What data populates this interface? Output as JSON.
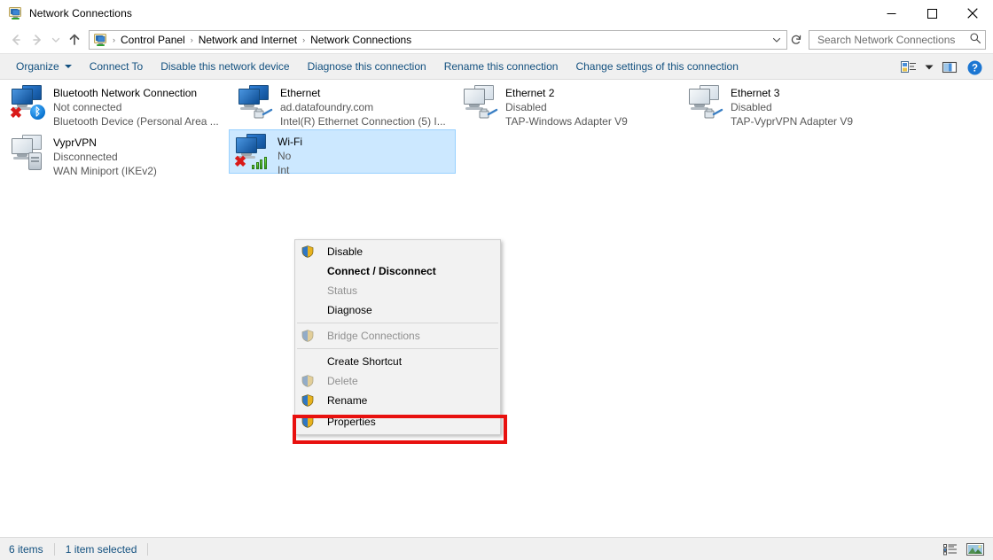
{
  "window": {
    "title": "Network Connections",
    "icon": "network-connections-icon",
    "buttons": {
      "minimize": "minimize-button",
      "maximize": "maximize-button",
      "close": "close-button"
    }
  },
  "navigation": {
    "back": "back-button",
    "forward": "forward-button",
    "recent": "recent-locations-button",
    "up": "up-button"
  },
  "address": {
    "icon": "network-connections-icon",
    "crumbs": [
      "Control Panel",
      "Network and Internet",
      "Network Connections"
    ],
    "separator": "›",
    "dropdown": "address-dropdown",
    "refresh": "refresh-button"
  },
  "search": {
    "placeholder": "Search Network Connections",
    "value": "",
    "icon": "search-icon"
  },
  "toolbar": {
    "items": [
      {
        "label": "Organize",
        "has_caret": true
      },
      {
        "label": "Connect To",
        "has_caret": false
      },
      {
        "label": "Disable this network device",
        "has_caret": false
      },
      {
        "label": "Diagnose this connection",
        "has_caret": false
      },
      {
        "label": "Rename this connection",
        "has_caret": false
      },
      {
        "label": "Change settings of this connection",
        "has_caret": false
      }
    ],
    "right_icons": [
      {
        "name": "change-view-icon"
      },
      {
        "name": "change-view-caret-icon"
      },
      {
        "name": "preview-pane-icon"
      },
      {
        "name": "help-icon"
      }
    ]
  },
  "connections": [
    {
      "name": "Bluetooth Network Connection",
      "status": "Not connected",
      "device": "Bluetooth Device (Personal Area ...",
      "icon": "network-adapter-icon",
      "badge": "bluetooth",
      "disconnected": true,
      "selected": false,
      "col": 0,
      "row": 0
    },
    {
      "name": "VyprVPN",
      "status": "Disconnected",
      "device": "WAN Miniport (IKEv2)",
      "icon": "network-adapter-icon",
      "badge": "server",
      "disconnected": false,
      "dimmed": true,
      "selected": false,
      "col": 0,
      "row": 1
    },
    {
      "name": "Ethernet",
      "status": "ad.datafoundry.com",
      "device": "Intel(R) Ethernet Connection (5) I...",
      "icon": "network-adapter-icon",
      "badge": "rj45",
      "disconnected": false,
      "selected": false,
      "col": 1,
      "row": 0
    },
    {
      "name": "Wi-Fi",
      "status": "No",
      "device": "Int",
      "icon": "network-adapter-icon",
      "badge": "wifi",
      "disconnected": true,
      "selected": true,
      "col": 1,
      "row": 1
    },
    {
      "name": "Ethernet 2",
      "status": "Disabled",
      "device": "TAP-Windows Adapter V9",
      "icon": "network-adapter-icon",
      "badge": "rj45",
      "disconnected": false,
      "dimmed": true,
      "selected": false,
      "col": 2,
      "row": 0
    },
    {
      "name": "Ethernet 3",
      "status": "Disabled",
      "device": "TAP-VyprVPN Adapter V9",
      "icon": "network-adapter-icon",
      "badge": "rj45",
      "disconnected": false,
      "dimmed": true,
      "selected": false,
      "col": 3,
      "row": 0
    }
  ],
  "context_menu": {
    "target": "Wi-Fi",
    "items": [
      {
        "label": "Disable",
        "shield": true,
        "disabled": false,
        "bold": false,
        "type": "item"
      },
      {
        "label": "Connect / Disconnect",
        "shield": false,
        "disabled": false,
        "bold": true,
        "type": "item"
      },
      {
        "label": "Status",
        "shield": false,
        "disabled": true,
        "bold": false,
        "type": "item"
      },
      {
        "label": "Diagnose",
        "shield": false,
        "disabled": false,
        "bold": false,
        "type": "item"
      },
      {
        "type": "separator"
      },
      {
        "label": "Bridge Connections",
        "shield": true,
        "disabled": true,
        "bold": false,
        "type": "item"
      },
      {
        "type": "separator"
      },
      {
        "label": "Create Shortcut",
        "shield": false,
        "disabled": false,
        "bold": false,
        "type": "item"
      },
      {
        "label": "Delete",
        "shield": true,
        "disabled": true,
        "bold": false,
        "type": "item"
      },
      {
        "label": "Rename",
        "shield": true,
        "disabled": false,
        "bold": false,
        "type": "item"
      },
      {
        "label": "Properties",
        "shield": true,
        "disabled": false,
        "bold": false,
        "type": "item",
        "highlighted": true
      }
    ]
  },
  "highlight": {
    "color": "#e8110f",
    "target_label": "Properties"
  },
  "statusbar": {
    "item_count": "6 items",
    "selection": "1 item selected",
    "views": [
      {
        "name": "details-view-button",
        "active": false
      },
      {
        "name": "large-icons-view-button",
        "active": true
      }
    ]
  },
  "colors": {
    "accent": "#12507f",
    "selection_fill": "#cce8ff",
    "selection_border": "#99d1ff",
    "chrome": "#f0f0f0",
    "highlight_red": "#e8110f"
  }
}
